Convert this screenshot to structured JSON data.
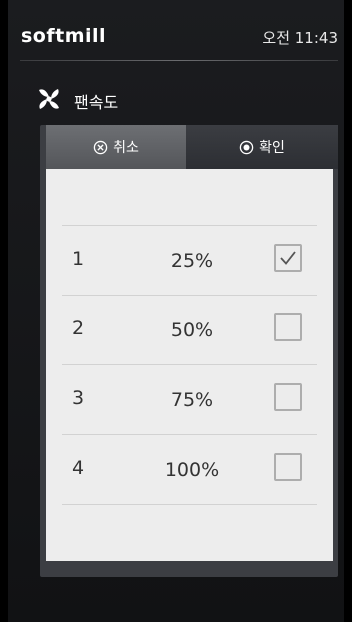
{
  "status": {
    "brand": "softmill",
    "time": "오전 11:43"
  },
  "header": {
    "title": "팬속도",
    "icon": "fan-icon"
  },
  "tabs": [
    {
      "label": "취소",
      "icon": "cancel-circle-icon"
    },
    {
      "label": "확인",
      "icon": "radio-dot-icon"
    }
  ],
  "speed_options": [
    {
      "number": "1",
      "percent": "25%",
      "checked": true
    },
    {
      "number": "2",
      "percent": "50%",
      "checked": false
    },
    {
      "number": "3",
      "percent": "75%",
      "checked": false
    },
    {
      "number": "4",
      "percent": "100%",
      "checked": false
    }
  ],
  "colors": {
    "background": "#000000",
    "panel": "#3c3e43",
    "list_background": "#ededed",
    "checkbox_border": "#adadad"
  }
}
